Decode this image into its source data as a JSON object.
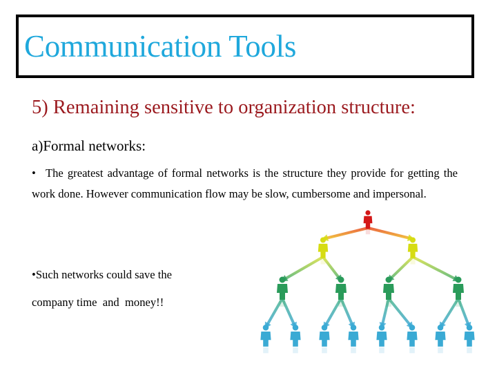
{
  "slide": {
    "title": "Communication Tools",
    "heading": "5) Remaining sensitive to organization structure:",
    "subheading": "a)Formal networks:",
    "bullet1": {
      "bullet": "•",
      "text": "The greatest advantage of formal networks is the structure they provide for getting the work done. However communication flow may be slow, cumbersome and impersonal."
    },
    "bullet2": {
      "bullet": "•",
      "line1": "Such networks could save the",
      "line2": "company time  and  money!!"
    },
    "image": {
      "description": "hierarchy-network-illustration",
      "levels": [
        {
          "name": "top",
          "count": 1,
          "color": "#d41818"
        },
        {
          "name": "level-2",
          "count": 2,
          "color": "#d6dc12"
        },
        {
          "name": "level-3",
          "count": 4,
          "color": "#2a9b5a"
        },
        {
          "name": "level-4",
          "count": 8,
          "color": "#3aaad4"
        }
      ]
    }
  },
  "colors": {
    "title": "#1fa8dc",
    "heading": "#9b1a1f",
    "body": "#000000",
    "border": "#000000"
  }
}
